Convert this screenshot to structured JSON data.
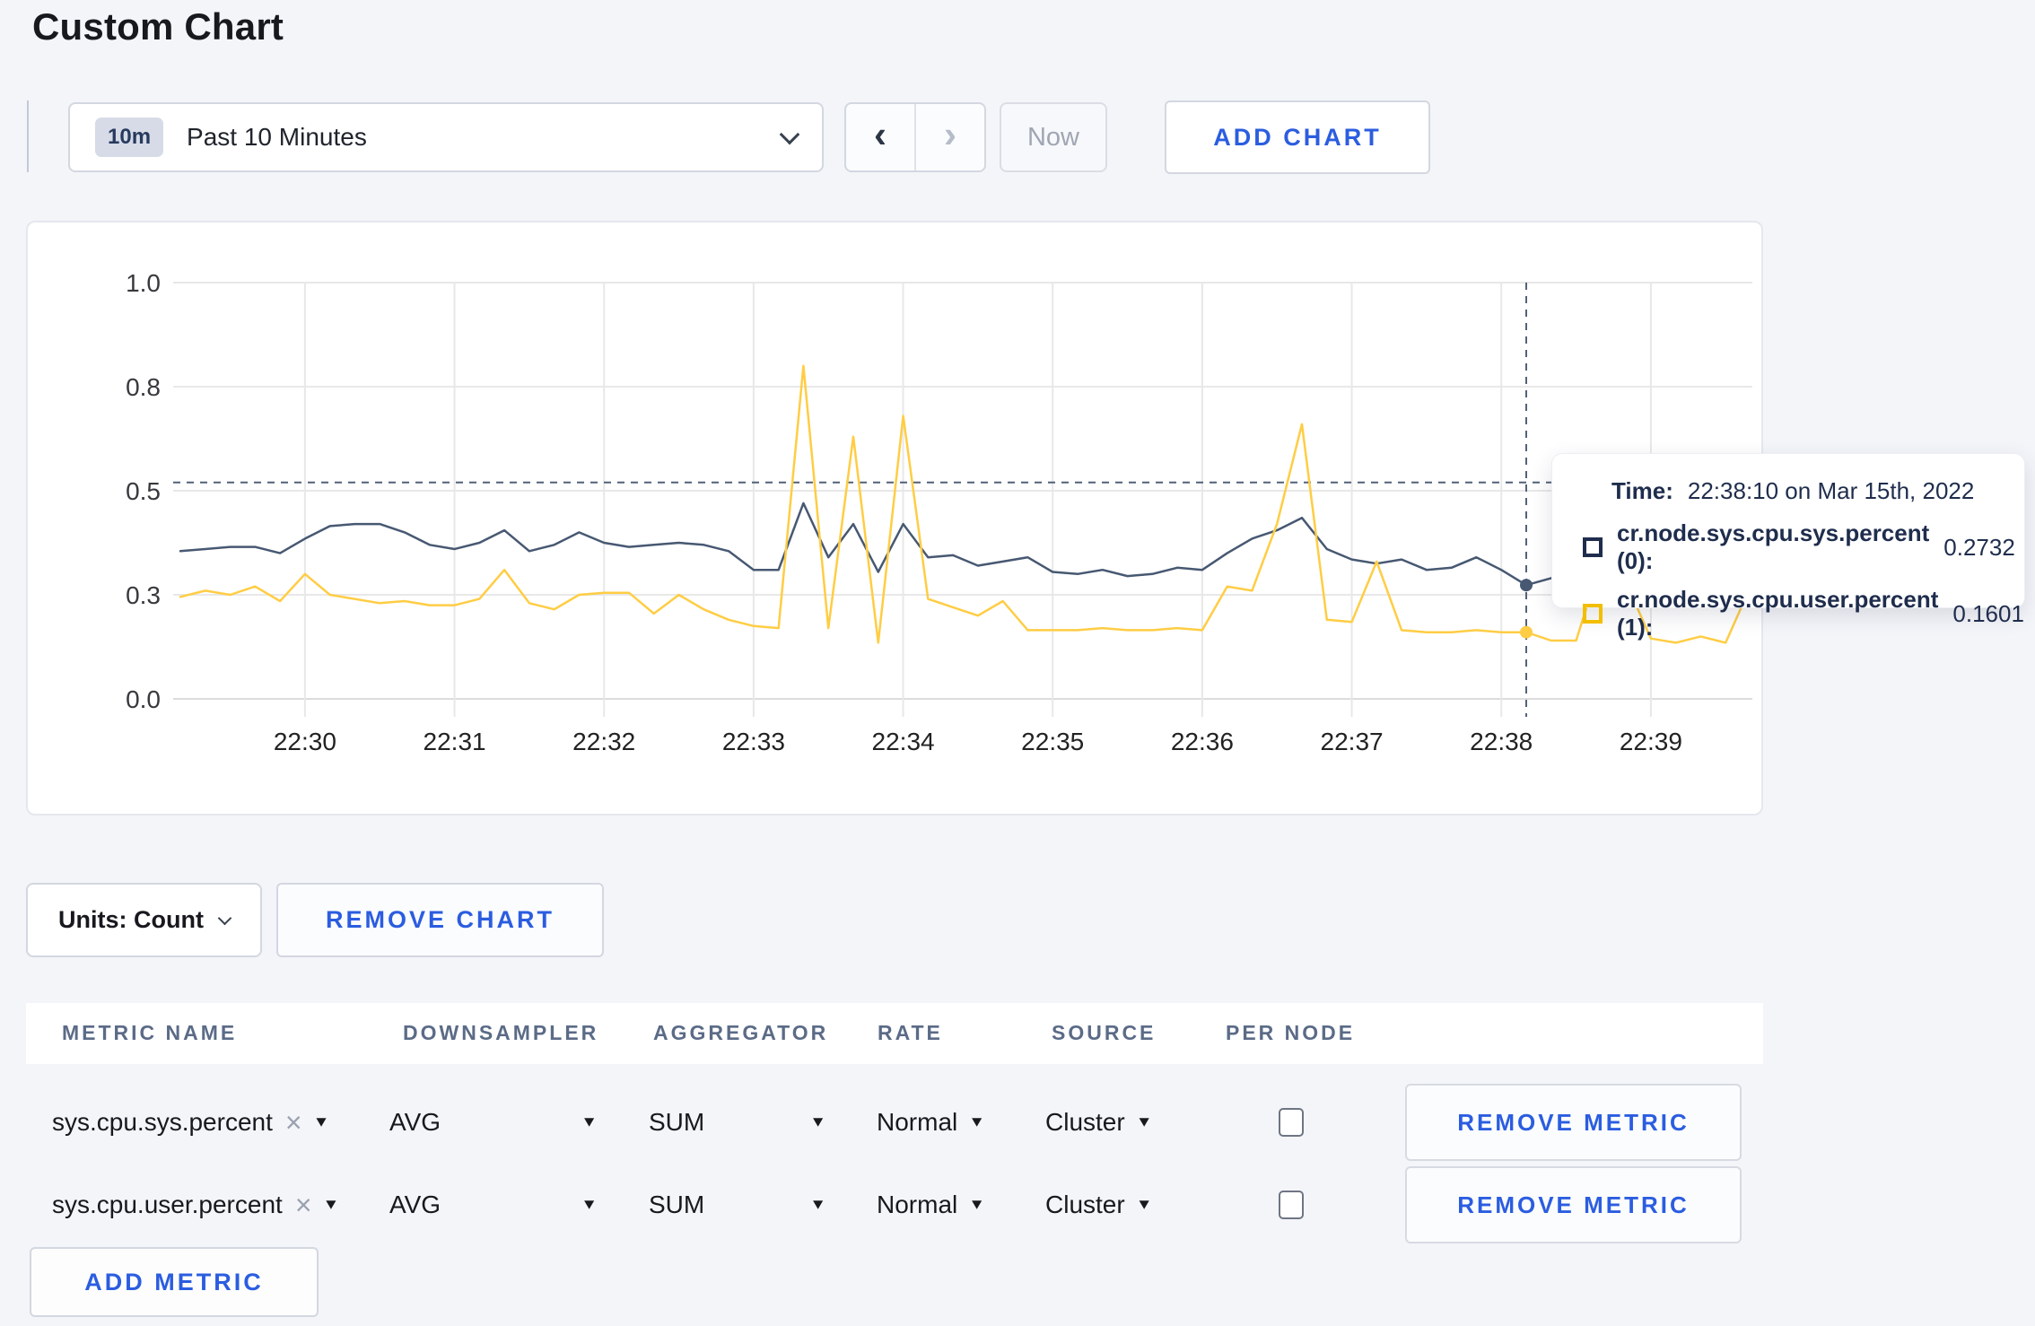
{
  "page": {
    "title": "Custom Chart"
  },
  "toolbar": {
    "time_window_badge": "10m",
    "time_window_label": "Past 10 Minutes",
    "prev_icon": "‹",
    "next_icon": "›",
    "now_label": "Now",
    "add_chart_label": "ADD CHART"
  },
  "tooltip": {
    "time_label": "Time:",
    "time_value": "22:38:10 on Mar 15th, 2022",
    "entries": [
      {
        "label": "cr.node.sys.cpu.sys.percent (0):",
        "value": "0.2732",
        "color": "#1f2d4d"
      },
      {
        "label": "cr.node.sys.cpu.user.percent (1):",
        "value": "0.1601",
        "color": "#f2be00"
      }
    ]
  },
  "chart_controls": {
    "units_label": "Units: Count",
    "remove_chart_label": "REMOVE CHART"
  },
  "metrics_table": {
    "headers": [
      "METRIC NAME",
      "DOWNSAMPLER",
      "AGGREGATOR",
      "RATE",
      "SOURCE",
      "PER NODE"
    ],
    "rows": [
      {
        "metric_name": "sys.cpu.sys.percent",
        "downsampler": "AVG",
        "aggregator": "SUM",
        "rate": "Normal",
        "source": "Cluster",
        "per_node_checked": false,
        "remove_label": "REMOVE METRIC"
      },
      {
        "metric_name": "sys.cpu.user.percent",
        "downsampler": "AVG",
        "aggregator": "SUM",
        "rate": "Normal",
        "source": "Cluster",
        "per_node_checked": false,
        "remove_label": "REMOVE METRIC"
      }
    ],
    "add_metric_label": "ADD METRIC"
  },
  "chart_data": {
    "type": "line",
    "title": "",
    "xlabel": "",
    "ylabel": "",
    "ylim": [
      0,
      1.0
    ],
    "grid": true,
    "legend_position": "none",
    "y_ticks": {
      "values": [
        1.0,
        0.75,
        0.5,
        0.25,
        0.0
      ],
      "labels": [
        "1.0",
        "0.8",
        "0.5",
        "0.3",
        "0.0"
      ]
    },
    "x_tick_labels": [
      "22:30",
      "22:31",
      "22:32",
      "22:33",
      "22:34",
      "22:35",
      "22:36",
      "22:37",
      "22:38",
      "22:39"
    ],
    "x_tick_indices": [
      5,
      11,
      17,
      23,
      29,
      35,
      41,
      47,
      53,
      59
    ],
    "x": [
      "22:29:10",
      "22:29:20",
      "22:29:30",
      "22:29:40",
      "22:29:50",
      "22:30:00",
      "22:30:10",
      "22:30:20",
      "22:30:30",
      "22:30:40",
      "22:30:50",
      "22:31:00",
      "22:31:10",
      "22:31:20",
      "22:31:30",
      "22:31:40",
      "22:31:50",
      "22:32:00",
      "22:32:10",
      "22:32:20",
      "22:32:30",
      "22:32:40",
      "22:32:50",
      "22:33:00",
      "22:33:10",
      "22:33:20",
      "22:33:30",
      "22:33:40",
      "22:33:50",
      "22:34:00",
      "22:34:10",
      "22:34:20",
      "22:34:30",
      "22:34:40",
      "22:34:50",
      "22:35:00",
      "22:35:10",
      "22:35:20",
      "22:35:30",
      "22:35:40",
      "22:35:50",
      "22:36:00",
      "22:36:10",
      "22:36:20",
      "22:36:30",
      "22:36:40",
      "22:36:50",
      "22:37:00",
      "22:37:10",
      "22:37:20",
      "22:37:30",
      "22:37:40",
      "22:37:50",
      "22:38:00",
      "22:38:10",
      "22:38:20",
      "22:38:30",
      "22:38:40",
      "22:38:50",
      "22:39:00",
      "22:39:10",
      "22:39:20",
      "22:39:30",
      "22:39:40"
    ],
    "series": [
      {
        "name": "cr.node.sys.cpu.sys.percent",
        "color": "#475872",
        "values": [
          0.355,
          0.36,
          0.365,
          0.365,
          0.35,
          0.385,
          0.415,
          0.42,
          0.42,
          0.4,
          0.37,
          0.36,
          0.375,
          0.405,
          0.355,
          0.37,
          0.4,
          0.375,
          0.365,
          0.37,
          0.375,
          0.37,
          0.355,
          0.31,
          0.31,
          0.47,
          0.34,
          0.42,
          0.305,
          0.42,
          0.34,
          0.345,
          0.32,
          0.33,
          0.34,
          0.305,
          0.3,
          0.31,
          0.295,
          0.3,
          0.315,
          0.31,
          0.35,
          0.385,
          0.405,
          0.435,
          0.36,
          0.335,
          0.325,
          0.335,
          0.31,
          0.315,
          0.34,
          0.31,
          0.2732,
          0.29,
          0.3,
          0.29,
          0.285,
          0.295,
          0.305,
          0.3,
          0.29,
          0.3
        ]
      },
      {
        "name": "cr.node.sys.cpu.user.percent",
        "color": "#ffcd44",
        "values": [
          0.245,
          0.26,
          0.25,
          0.27,
          0.235,
          0.3,
          0.25,
          0.24,
          0.23,
          0.235,
          0.225,
          0.225,
          0.24,
          0.31,
          0.23,
          0.215,
          0.25,
          0.255,
          0.255,
          0.205,
          0.25,
          0.215,
          0.19,
          0.175,
          0.17,
          0.8,
          0.17,
          0.63,
          0.135,
          0.68,
          0.24,
          0.22,
          0.2,
          0.235,
          0.165,
          0.165,
          0.165,
          0.17,
          0.165,
          0.165,
          0.17,
          0.165,
          0.27,
          0.26,
          0.42,
          0.66,
          0.19,
          0.185,
          0.33,
          0.165,
          0.16,
          0.16,
          0.165,
          0.16,
          0.1601,
          0.14,
          0.14,
          0.33,
          0.28,
          0.145,
          0.135,
          0.15,
          0.135,
          0.27
        ]
      }
    ],
    "crosshair": {
      "index": 54,
      "time": "22:38:10",
      "hover_value": 0.52,
      "color": "#52617a"
    }
  }
}
